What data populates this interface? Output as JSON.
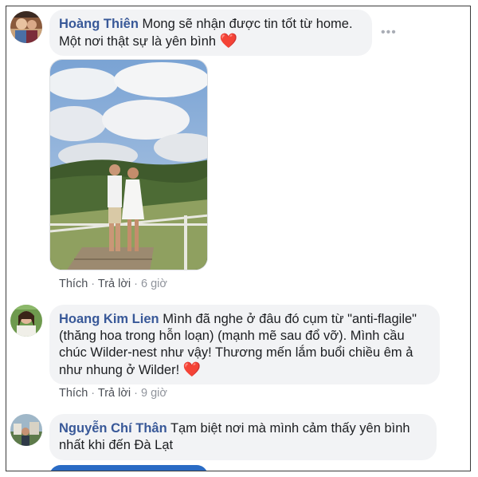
{
  "comments": [
    {
      "author": "Hoàng Thiên",
      "line1": "Mong sẽ nhận được tin tốt từ home.",
      "line2": "Một nơi thật sự là yên bình",
      "heart": "❤️",
      "actions": {
        "like": "Thích",
        "sep1": " · ",
        "reply": "Trả lời",
        "sep2": " · ",
        "time": "6 giờ"
      },
      "more": "•••"
    },
    {
      "author": "Hoang Kim Lien",
      "line1": "Mình đã nghe ở đâu đó cụm từ \"anti-flagile\"",
      "line2": "(thăng hoa trong hỗn loạn) (mạnh mẽ sau đổ vỡ). Mình cầu",
      "line3": "chúc Wilder-nest như vậy! Thương mến lắm buổi chiều êm ả",
      "line4": "như nhung ở Wilder!",
      "heart": "❤️",
      "actions": {
        "like": "Thích",
        "sep1": " · ",
        "reply": "Trả lời",
        "sep2": " · ",
        "time": "9 giờ"
      }
    },
    {
      "author": "Nguyễn Chí Thân",
      "line1": "Tạm biệt nơi mà mình cảm thấy yên bình",
      "line2": "nhất khi đến Đà Lạt"
    }
  ],
  "colors": {
    "author": "#385898",
    "bubble": "#f2f3f5",
    "meta": "#90949c",
    "heart": "#e0245e"
  },
  "icons": [
    "avatar-hoang-thien",
    "avatar-hoang-kim-lien",
    "avatar-nguyen-chi-than",
    "more-options-icon",
    "heart-emoji"
  ]
}
